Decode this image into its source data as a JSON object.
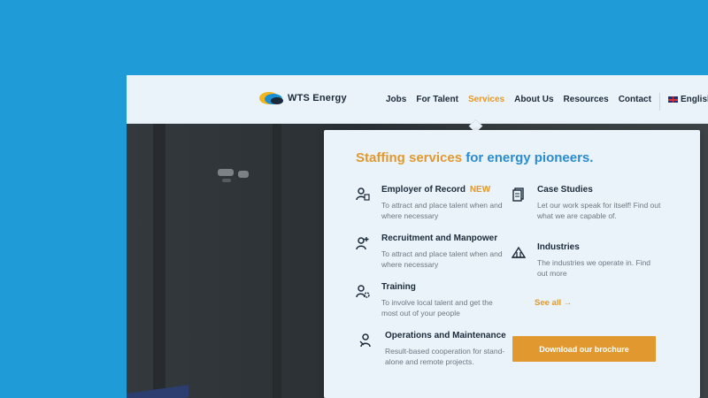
{
  "colors": {
    "background": "#1f9bd8",
    "accent": "#e1992f",
    "heading_blue": "#2a8ccf",
    "navbar_bg": "#eaf3fa",
    "text_dark": "#1b2a3a"
  },
  "header": {
    "logo_text": "WTS Energy",
    "nav": [
      {
        "label": "Jobs",
        "active": false
      },
      {
        "label": "For Talent",
        "active": false
      },
      {
        "label": "Services",
        "active": true
      },
      {
        "label": "About Us",
        "active": false
      },
      {
        "label": "Resources",
        "active": false
      },
      {
        "label": "Contact",
        "active": false
      }
    ],
    "language": "English"
  },
  "dropdown": {
    "heading_part1": "Staffing services",
    "heading_part2": "for energy pioneers.",
    "services": [
      {
        "title": "Employer of Record",
        "badge": "NEW",
        "desc": "To attract and place talent when and where necessary",
        "icon": "person-document-icon"
      },
      {
        "title": "Recruitment and Manpower",
        "desc": "To attract and place talent when and where necessary",
        "icon": "person-plus-icon"
      },
      {
        "title": "Training",
        "desc": "To involve local talent and get the most out of your people",
        "icon": "person-gear-icon"
      },
      {
        "title": "Operations and Maintenance",
        "desc": "Result-based cooperation for stand-alone and remote projects.",
        "icon": "person-wrench-icon"
      }
    ],
    "resources": [
      {
        "title": "Case Studies",
        "desc": "Let our work speak for itself! Find out what we are capable of.",
        "icon": "documents-icon"
      },
      {
        "title": "Industries",
        "desc": "The industries we operate in. Find out more",
        "icon": "industry-icon"
      }
    ],
    "see_all": "See all →",
    "brochure_button": "Download our brochure"
  }
}
